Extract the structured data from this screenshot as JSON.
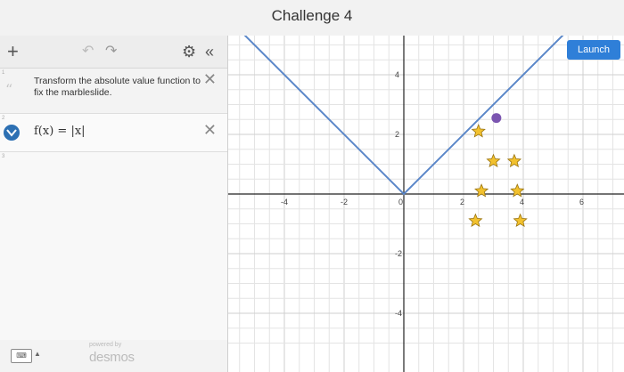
{
  "window": {
    "title": "Challenge 4"
  },
  "toolbar": {
    "add_icon": "plus-icon",
    "undo_icon": "undo-icon",
    "redo_icon": "redo-icon",
    "settings_icon": "gear-icon",
    "collapse_icon": "double-chevron-left-icon"
  },
  "expressions": {
    "note": {
      "index": "1",
      "text": "Transform the absolute value function to fix the marbleslide."
    },
    "function": {
      "index": "2",
      "formula": "f(x) = |x|",
      "color": "#2d70b3"
    },
    "empty": {
      "index": "3"
    }
  },
  "footer": {
    "keyboard_label": "⌨",
    "powered_by": "powered by",
    "brand": "desmos"
  },
  "graph": {
    "launch_label": "Launch",
    "launch_color": "#2f7fd8",
    "grid_color": "#e4e4e4",
    "axis_color": "#222222",
    "curve_color": "#5b87c9",
    "star_color": "#f2c12e",
    "marble_color": "#7b55b0",
    "x_ticks": [
      "-4",
      "-2",
      "0",
      "2",
      "4",
      "6"
    ],
    "y_ticks": [
      "4",
      "2",
      "-2",
      "-4"
    ]
  },
  "chart_data": {
    "type": "scatter",
    "xlim": [
      -8,
      7
    ],
    "ylim": [
      -5.1,
      5.1
    ],
    "grid": true,
    "series": [
      {
        "kind": "line",
        "formula": "f(x) = |x|",
        "points": [
          [
            -6.5,
            6.5
          ],
          [
            0,
            0
          ],
          [
            6.5,
            6.5
          ]
        ]
      },
      {
        "kind": "stars",
        "points": [
          [
            2.5,
            2.1
          ],
          [
            3,
            1.1
          ],
          [
            3.7,
            1.1
          ],
          [
            2.6,
            0.1
          ],
          [
            3.8,
            0.1
          ],
          [
            2.4,
            -0.9
          ],
          [
            3.9,
            -0.9
          ]
        ]
      },
      {
        "kind": "marble",
        "points": [
          [
            3.1,
            2.55
          ]
        ]
      }
    ]
  }
}
